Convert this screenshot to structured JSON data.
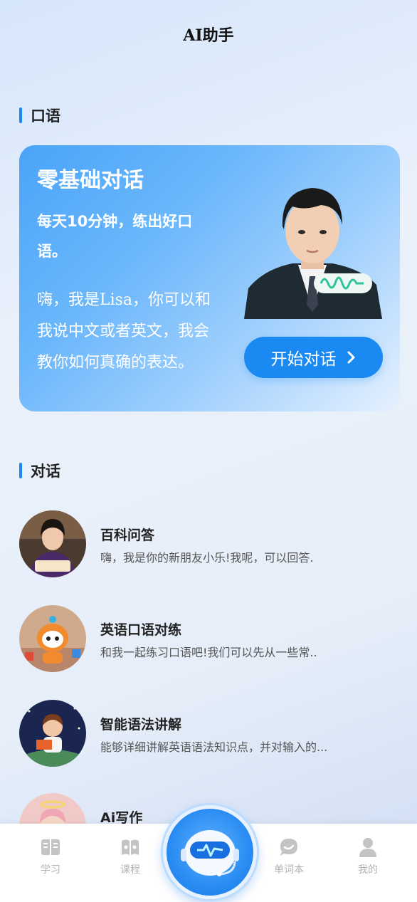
{
  "header": {
    "title": "AI助手"
  },
  "sections": {
    "oral": "口语",
    "dialogue": "对话"
  },
  "hero": {
    "title": "零基础对话",
    "subtitle": "每天10分钟，练出好口语。",
    "description": "嗨，我是Lisa，你可以和我说中文或者英文，我会教你如何真确的表达。",
    "button_label": "开始对话"
  },
  "conversations": [
    {
      "name": "百科问答",
      "desc": "嗨，我是你的新朋友小乐!我呢，可以回答."
    },
    {
      "name": "英语口语对练",
      "desc": "和我一起练习口语吧!我们可以先从一些常.."
    },
    {
      "name": "智能语法讲解",
      "desc": "能够详细讲解英语语法知识点，并对输入的..."
    },
    {
      "name": "Ai写作",
      "desc": ""
    }
  ],
  "tabs": [
    {
      "label": "学习",
      "icon": "book-icon"
    },
    {
      "label": "课程",
      "icon": "course-icon"
    },
    {
      "label": "",
      "icon": "robot-icon"
    },
    {
      "label": "单词本",
      "icon": "chat-icon"
    },
    {
      "label": "我的",
      "icon": "user-icon"
    }
  ],
  "colors": {
    "accent": "#1a8af2",
    "tab_inactive": "#b3b3b3"
  }
}
